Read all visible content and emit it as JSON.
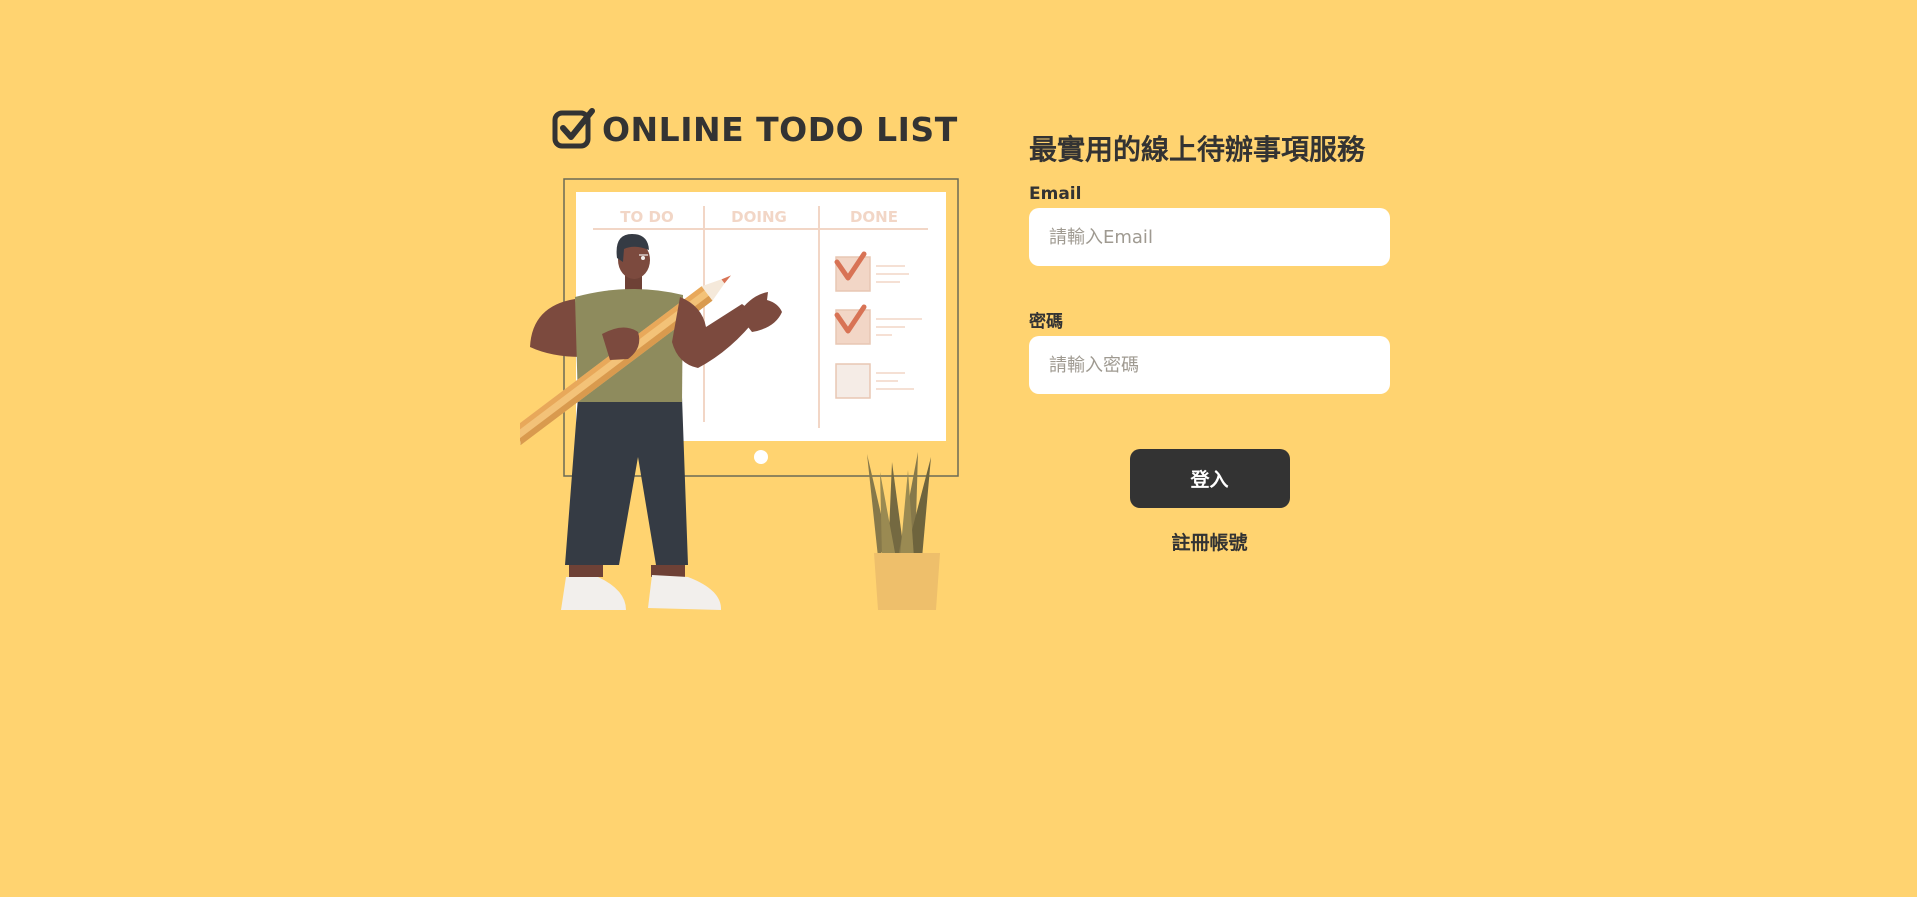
{
  "brand": {
    "logo_icon": "checkbox-checked-icon",
    "name": "ONLINE TODO LIST"
  },
  "illustration": {
    "columns": [
      "TO DO",
      "DOING",
      "DONE"
    ],
    "done_checkboxes": [
      true,
      true,
      false
    ]
  },
  "login": {
    "headline": "最實用的線上待辦事項服務",
    "email_label": "Email",
    "email_placeholder": "請輸入Email",
    "email_value": "",
    "password_label": "密碼",
    "password_placeholder": "請輸入密碼",
    "password_value": "",
    "submit_label": "登入",
    "register_label": "註冊帳號"
  },
  "colors": {
    "background": "#FFD370",
    "text": "#333333",
    "button": "#333333",
    "button_text": "#FFFFFF",
    "input_background": "#FFFFFF",
    "check_accent": "#D87355"
  }
}
